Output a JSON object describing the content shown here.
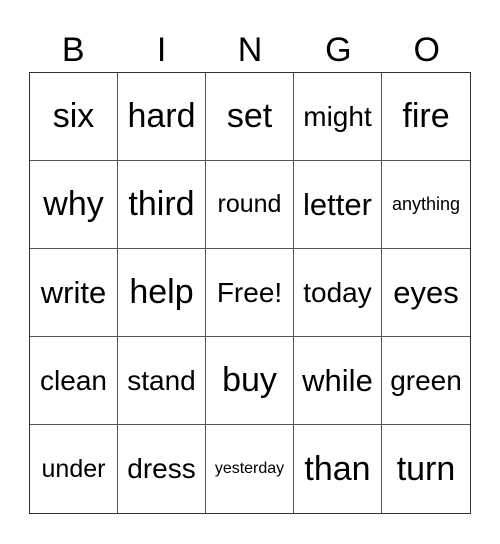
{
  "header": [
    "B",
    "I",
    "N",
    "G",
    "O"
  ],
  "cells": [
    [
      "six",
      "hard",
      "set",
      "might",
      "fire"
    ],
    [
      "why",
      "third",
      "round",
      "letter",
      "anything"
    ],
    [
      "write",
      "help",
      "Free!",
      "today",
      "eyes"
    ],
    [
      "clean",
      "stand",
      "buy",
      "while",
      "green"
    ],
    [
      "under",
      "dress",
      "yesterday",
      "than",
      "turn"
    ]
  ]
}
